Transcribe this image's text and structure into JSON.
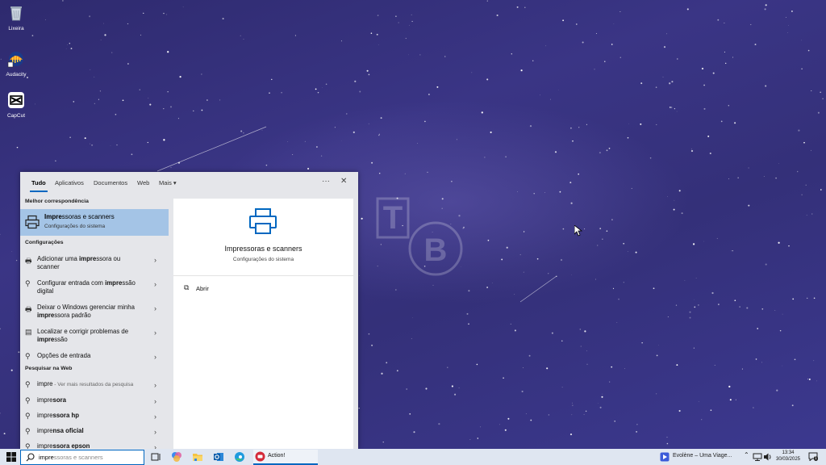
{
  "desktop": {
    "icons": [
      {
        "label": "Lixeira",
        "icon": "recycle-bin-icon"
      },
      {
        "label": "Audacity",
        "icon": "audacity-icon"
      },
      {
        "label": "CapCut",
        "icon": "capcut-icon"
      }
    ],
    "watermark_letters": [
      "T",
      "B"
    ]
  },
  "search_panel": {
    "tabs": [
      {
        "label": "Tudo",
        "active": true
      },
      {
        "label": "Aplicativos"
      },
      {
        "label": "Documentos"
      },
      {
        "label": "Web"
      },
      {
        "label": "Mais ▾"
      }
    ],
    "more_options": "···",
    "close": "✕",
    "best_match_header": "Melhor correspondência",
    "best_match": {
      "title": "Impressoras e scanners",
      "title_bold": "Impre",
      "title_rest": "ssoras e scanners",
      "subtitle": "Configurações do sistema"
    },
    "settings_header": "Configurações",
    "settings": [
      {
        "line1_a": "Adicionar uma ",
        "line1_b": "impre",
        "line1_c": "ssora ou",
        "line2_a": "scanner",
        "line2_b": "",
        "line2_c": ""
      },
      {
        "line1_a": "Configurar entrada com ",
        "line1_b": "impre",
        "line1_c": "ssão",
        "line2_a": "digital",
        "line2_b": "",
        "line2_c": ""
      },
      {
        "line1_a": "Deixar o Windows gerenciar minha",
        "line1_b": "",
        "line1_c": "",
        "line2_a": "",
        "line2_b": "impre",
        "line2_c": "ssora padrão"
      },
      {
        "line1_a": "Localizar e corrigir problemas de",
        "line1_b": "",
        "line1_c": "",
        "line2_a": "",
        "line2_b": "impre",
        "line2_c": "ssão"
      },
      {
        "line1_a": "Opções de entrada",
        "line1_b": "",
        "line1_c": "",
        "line2_a": "",
        "line2_b": "",
        "line2_c": ""
      }
    ],
    "web_header": "Pesquisar na Web",
    "web": [
      {
        "a": "impre",
        "b": "",
        "hint": " - Ver mais resultados da pesquisa"
      },
      {
        "a": "impre",
        "b": "sora",
        "hint": ""
      },
      {
        "a": "impre",
        "b": "ssora hp",
        "hint": ""
      },
      {
        "a": "impre",
        "b": "nsa oficial",
        "hint": ""
      },
      {
        "a": "impre",
        "b": "ssora epson",
        "hint": ""
      }
    ],
    "preview": {
      "title": "Impressoras e scanners",
      "subtitle": "Configurações do sistema",
      "open_label": "Abrir"
    }
  },
  "taskbar": {
    "search_typed": "impre",
    "search_suggestion": "ssoras e scanners",
    "pinned_app_label": "Action!",
    "media_title": "Evolène – Uma Viage...",
    "time": "13:34",
    "date": "30/03/2025",
    "notification_count": "1"
  },
  "colors": {
    "accent": "#0067c0",
    "selected_row": "#a4c4e6",
    "panel_bg": "#e5e6ea",
    "taskbar_bg": "#dfe6f1"
  }
}
